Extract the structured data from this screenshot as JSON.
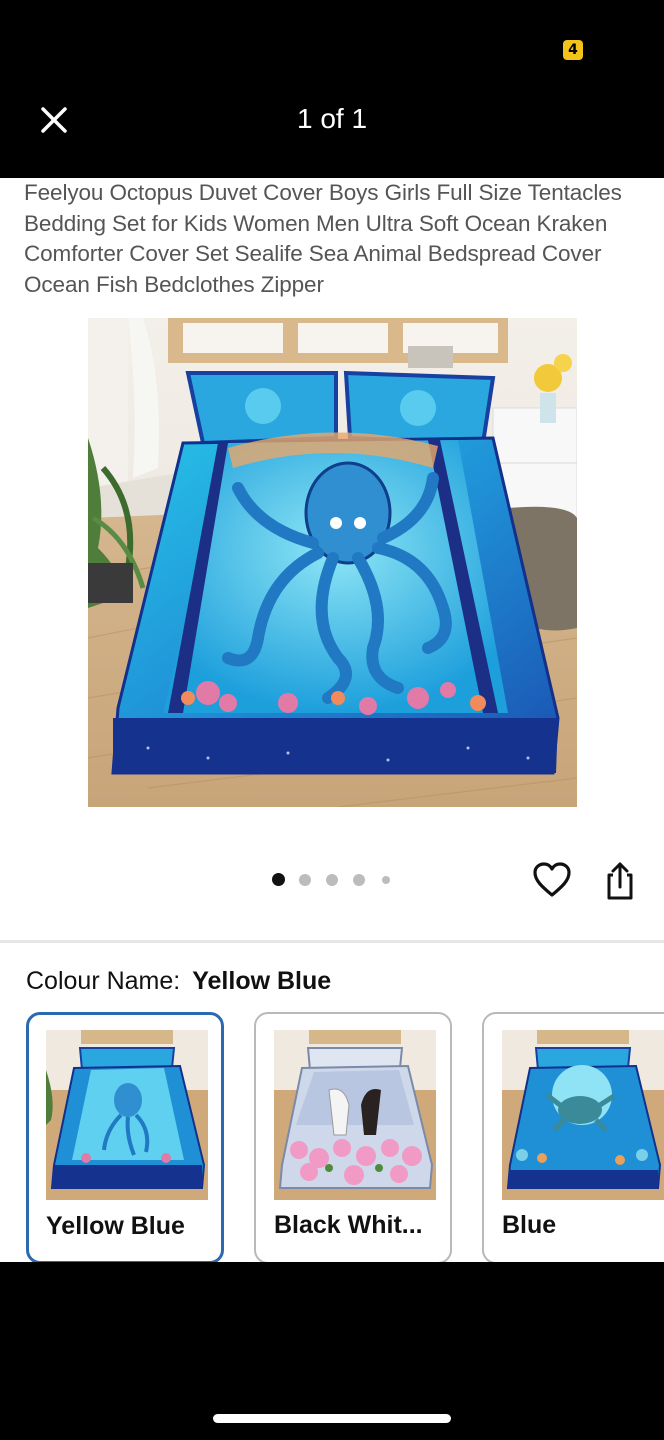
{
  "status_bar": {
    "badge": "4",
    "badge_color": "#f3c319"
  },
  "header": {
    "counter": "1 of 1",
    "close_icon": "close-icon"
  },
  "product": {
    "title": "Feelyou Octopus Duvet Cover Boys Girls Full Size Tentacles Bedding Set for Kids Women Men Ultra Soft Ocean Kraken Comforter Cover Set Sealife Sea Animal Bedspread Cover Ocean Fish Bedclothes Zipper",
    "image_name": "octopus-bedding-image"
  },
  "carousel": {
    "dot_count": 5,
    "active_index": 0
  },
  "actions": {
    "favorite_icon": "heart-icon",
    "share_icon": "share-icon"
  },
  "colour": {
    "label": "Colour Name:",
    "selected": "Yellow Blue",
    "options": [
      {
        "label": "Yellow Blue",
        "selected": true
      },
      {
        "label": "Black Whit...",
        "selected": false
      },
      {
        "label": "Blue",
        "selected": false
      }
    ]
  },
  "colors": {
    "selected_border": "#2b6ab0",
    "background": "#ffffff",
    "bar": "#000000"
  }
}
